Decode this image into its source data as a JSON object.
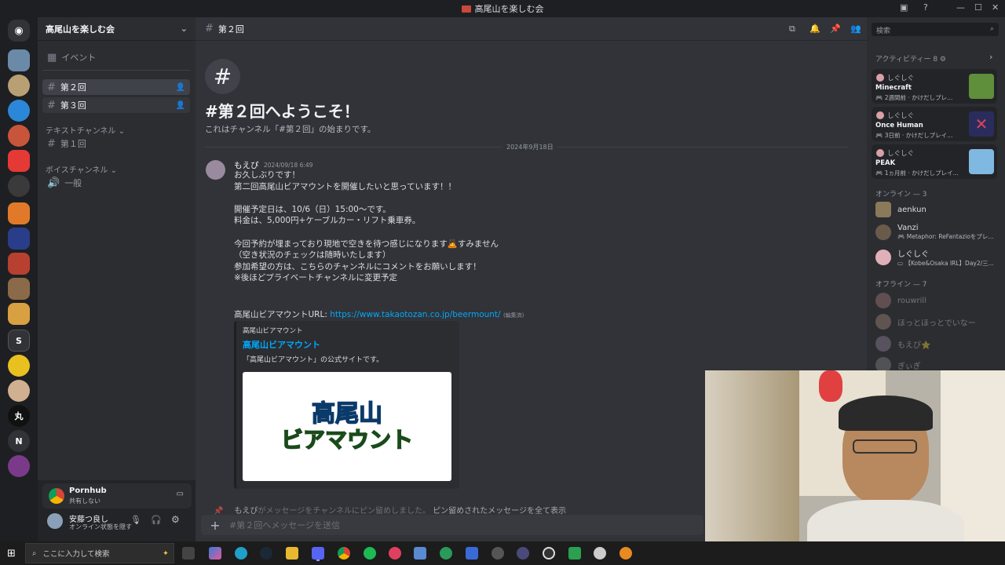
{
  "window": {
    "title": "高尾山を楽しむ会"
  },
  "server": {
    "name": "高尾山を楽しむ会"
  },
  "channels": {
    "events_label": "イベント",
    "active": [
      {
        "name": "第２回",
        "selected": true
      },
      {
        "name": "第３回",
        "selected": false
      }
    ],
    "text_category": "テキストチャンネル",
    "text_channels": [
      "第１回"
    ],
    "voice_category": "ボイスチャンネル",
    "voice_channels": [
      "一般"
    ]
  },
  "activity_panel": {
    "app": "Pornhub",
    "status": "共有しない"
  },
  "user": {
    "name": "安藤つ良し",
    "status": "オンライン状態を隠す"
  },
  "chat": {
    "channel_name": "第２回",
    "welcome_title": "#第２回へようこそ！",
    "welcome_sub": "これはチャンネル「#第２回」の始まりです。",
    "date_divider": "2024年9月18日",
    "message": {
      "author": "もえぴ",
      "timestamp": "2024/09/18 6:49",
      "lines": [
        "お久しぶりです！",
        "第二回高尾山ビアマウントを開催したいと思っています！！",
        "",
        "開催予定日は、10/6（日）15:00～です。",
        "料金は、5,000円+ケーブルカー・リフト乗車券。",
        "",
        "今回予約が埋まっており現地で空きを待つ感じになります🙇すみません",
        "（空き状況のチェックは随時いたします）",
        "参加希望の方は、こちらのチャンネルにコメントをお願いします！",
        "※後ほどプライベートチャンネルに変更予定"
      ],
      "url_label": "高尾山ビアマウントURL: ",
      "url": "https://www.takaotozan.co.jp/beermount/",
      "edited": "(編集済)"
    },
    "embed": {
      "provider": "高尾山ビアマウント",
      "title": "高尾山ビアマウント",
      "description": "「高尾山ビアマウント」の公式サイトです。",
      "logo_line1": "高尾山",
      "logo_line2": "ビアマウント"
    },
    "pin_notice": {
      "author": "もえぴ",
      "text": "がメッセージをチャンネルにピン留めしました。",
      "link": "ピン留めされたメッセージを全て表示"
    },
    "composer_placeholder": "#第２回へメッセージを送信"
  },
  "members": {
    "search_placeholder": "検索",
    "activity_header": "アクティビティー 8",
    "activities": [
      {
        "user": "しぐしぐ",
        "game": "Minecraft",
        "meta": "2週間前",
        "detail": "かけだしプレ...",
        "color": "#5f8f3a"
      },
      {
        "user": "しぐしぐ",
        "game": "Once Human",
        "meta": "3日前",
        "detail": "かけだしプレイ...",
        "color": "#2a2d5c"
      },
      {
        "user": "しぐしぐ",
        "game": "PEAK",
        "meta": "1ヵ月前",
        "detail": "かけだしプレイ...",
        "color": "#7fb8e0"
      }
    ],
    "online_header": "オンライン — 3",
    "online": [
      {
        "name": "aenkun",
        "status": ""
      },
      {
        "name": "Vanzi",
        "status": "Metaphor: ReFantazioをプレ..."
      },
      {
        "name": "しぐしぐ",
        "status": "【Kobe&Osaka IRL】Day2/三..."
      }
    ],
    "offline_header": "オフライン — 7",
    "offline": [
      "rouwrill",
      "ほっとほっとでいなー",
      "もえぴ⭐",
      "ぎぃぎ"
    ]
  },
  "taskbar": {
    "search_placeholder": "ここに入力して検索"
  }
}
